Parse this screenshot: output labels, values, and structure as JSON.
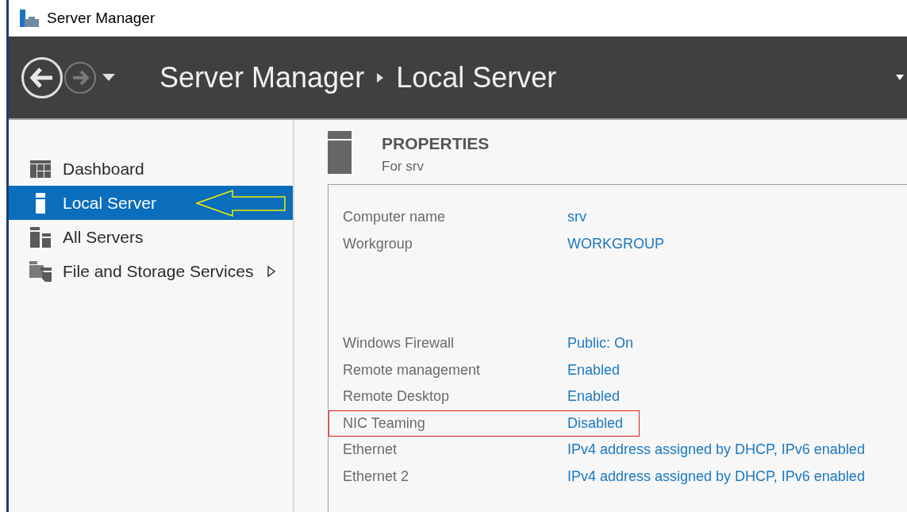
{
  "window": {
    "title": "Server Manager"
  },
  "header": {
    "breadcrumb": [
      {
        "label": "Server Manager"
      },
      {
        "label": "Local Server"
      }
    ]
  },
  "sidebar": {
    "items": [
      {
        "label": "Dashboard",
        "kind": "dashboard",
        "selected": false,
        "annotated": false,
        "expandable": false
      },
      {
        "label": "Local Server",
        "kind": "server",
        "selected": true,
        "annotated": true,
        "expandable": false
      },
      {
        "label": "All Servers",
        "kind": "servers",
        "selected": false,
        "annotated": false,
        "expandable": false
      },
      {
        "label": "File and Storage Services",
        "kind": "storage",
        "selected": false,
        "annotated": false,
        "expandable": true
      }
    ]
  },
  "properties": {
    "title": "PROPERTIES",
    "subtitle": "For srv",
    "groups": [
      [
        {
          "label": "Computer name",
          "value": "srv",
          "highlighted": false
        },
        {
          "label": "Workgroup",
          "value": "WORKGROUP",
          "highlighted": false
        }
      ],
      [
        {
          "label": "Windows Firewall",
          "value": "Public: On",
          "highlighted": false
        },
        {
          "label": "Remote management",
          "value": "Enabled",
          "highlighted": false
        },
        {
          "label": "Remote Desktop",
          "value": "Enabled",
          "highlighted": false
        },
        {
          "label": "NIC Teaming",
          "value": "Disabled",
          "highlighted": true
        },
        {
          "label": "Ethernet",
          "value": "IPv4 address assigned by DHCP, IPv6 enabled",
          "highlighted": false
        },
        {
          "label": "Ethernet 2",
          "value": "IPv4 address assigned by DHCP, IPv6 enabled",
          "highlighted": false
        }
      ]
    ]
  }
}
